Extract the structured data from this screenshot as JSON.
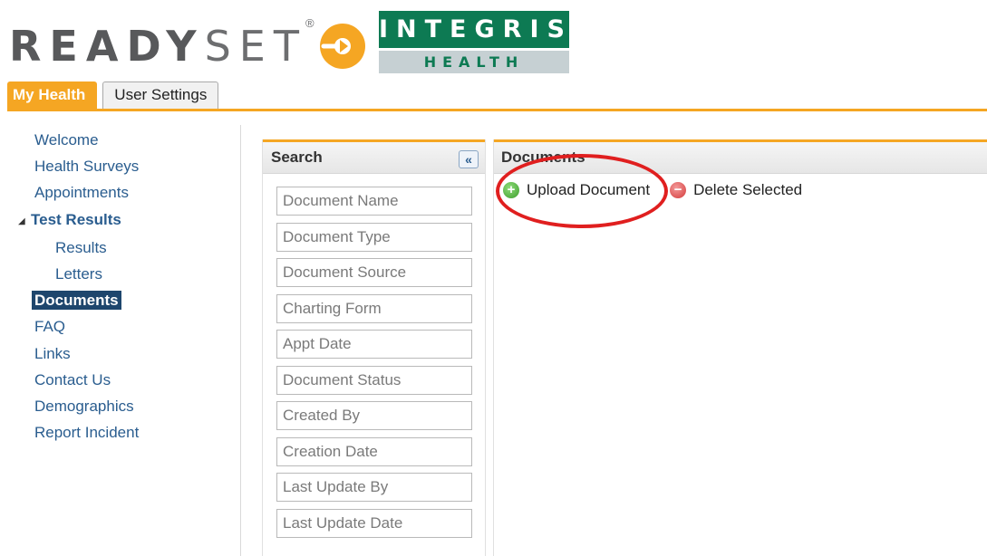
{
  "brand": {
    "readyset_bold": "READY",
    "readyset_light": "SET",
    "registered": "®",
    "integris_top": "INTEGRIS",
    "integris_bottom": "HEALTH",
    "colors": {
      "orange": "#f5a623",
      "green": "#0d7a53",
      "nav_blue": "#1e466d"
    }
  },
  "tabs": [
    {
      "label": "My Health",
      "active": true
    },
    {
      "label": "User Settings",
      "active": false
    }
  ],
  "leftnav": {
    "items": [
      {
        "label": "Welcome"
      },
      {
        "label": "Health Surveys"
      },
      {
        "label": "Appointments"
      },
      {
        "label": "Test Results",
        "expanded": true
      },
      {
        "label": "Results"
      },
      {
        "label": "Letters"
      },
      {
        "label": "Documents",
        "current": true
      },
      {
        "label": "FAQ"
      },
      {
        "label": "Links"
      },
      {
        "label": "Contact Us"
      },
      {
        "label": "Demographics"
      },
      {
        "label": "Report Incident"
      }
    ]
  },
  "search": {
    "title": "Search",
    "collapse_icon": "double-chevron-left-icon",
    "collapse_glyph": "«",
    "fields": [
      {
        "placeholder": "Document Name",
        "value": ""
      },
      {
        "placeholder": "Document Type",
        "value": ""
      },
      {
        "placeholder": "Document Source",
        "value": ""
      },
      {
        "placeholder": "Charting Form",
        "value": ""
      },
      {
        "placeholder": "Appt Date",
        "value": ""
      },
      {
        "placeholder": "Document Status",
        "value": ""
      },
      {
        "placeholder": "Created By",
        "value": ""
      },
      {
        "placeholder": "Creation Date",
        "value": ""
      },
      {
        "placeholder": "Last Update By",
        "value": ""
      },
      {
        "placeholder": "Last Update Date",
        "value": ""
      }
    ]
  },
  "documents": {
    "title": "Documents",
    "upload_label": "Upload Document",
    "upload_icon": "plus-circle-icon",
    "upload_glyph": "+",
    "delete_label": "Delete Selected",
    "delete_icon": "minus-circle-icon",
    "delete_glyph": "−"
  },
  "annotation": {
    "color": "#e01f1f"
  }
}
